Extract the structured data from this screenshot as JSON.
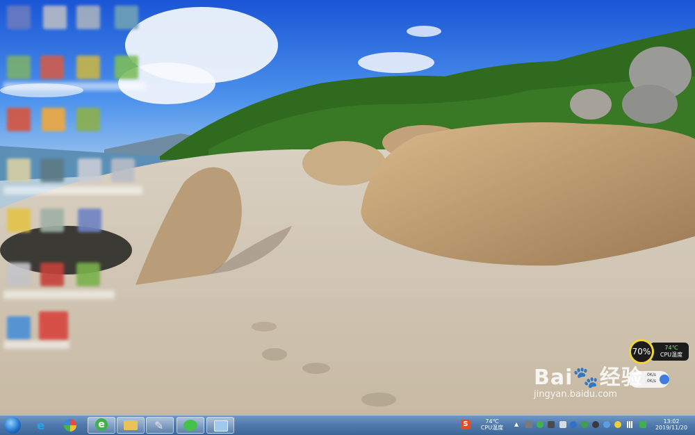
{
  "watermark": {
    "brand": "Bai",
    "brand_cn": "经验",
    "url": "jingyan.baidu.com"
  },
  "cpu_widget": {
    "load": "70%",
    "temp": "74℃",
    "label": "CPU温度",
    "net_up": "0K/s",
    "net_down": "0K/s"
  },
  "tray": {
    "temp": "74℃",
    "temp_label": "CPU温度",
    "time": "13:02",
    "date": "2019/11/20"
  },
  "colors": {
    "taskbar": "#4f79aa",
    "widget_ring": "#f2d534",
    "widget_bg": "#1c1c1c"
  },
  "taskbar_apps": [
    {
      "icon": "start-orb-icon"
    },
    {
      "icon": "ie-icon"
    },
    {
      "icon": "app-360-icon"
    },
    {
      "icon": "ie-browser-icon"
    },
    {
      "icon": "folder-icon"
    },
    {
      "icon": "tools-icon"
    },
    {
      "icon": "wechat-icon"
    },
    {
      "icon": "remote-desktop-icon"
    }
  ]
}
